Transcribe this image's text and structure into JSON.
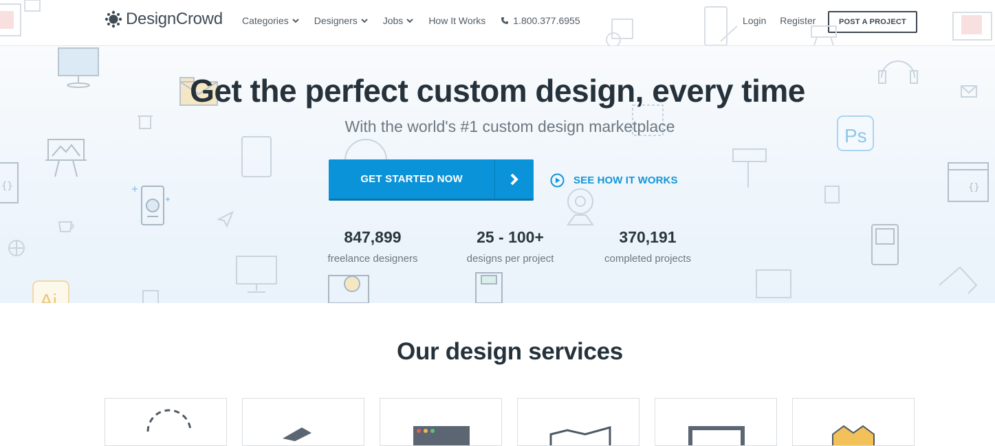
{
  "header": {
    "logo_text": "DesignCrowd",
    "nav": [
      {
        "label": "Categories"
      },
      {
        "label": "Designers"
      },
      {
        "label": "Jobs"
      }
    ],
    "how_it_works": "How It Works",
    "phone": "1.800.377.6955",
    "login": "Login",
    "register": "Register",
    "post_project": "POST A PROJECT"
  },
  "hero": {
    "title": "Get the perfect custom design, every time",
    "subtitle": "With the world's #1 custom design marketplace",
    "cta_label": "GET STARTED NOW",
    "see_how": "SEE HOW IT WORKS",
    "stats": [
      {
        "value": "847,899",
        "label": "freelance designers"
      },
      {
        "value": "25 - 100+",
        "label": "designs per project"
      },
      {
        "value": "370,191",
        "label": "completed projects"
      }
    ],
    "bg_text": {
      "ps": "Ps",
      "ai": "Ai"
    }
  },
  "services": {
    "title": "Our design services"
  },
  "colors": {
    "accent": "#0b93d9",
    "heading": "#26323b",
    "muted": "#6d7780"
  }
}
